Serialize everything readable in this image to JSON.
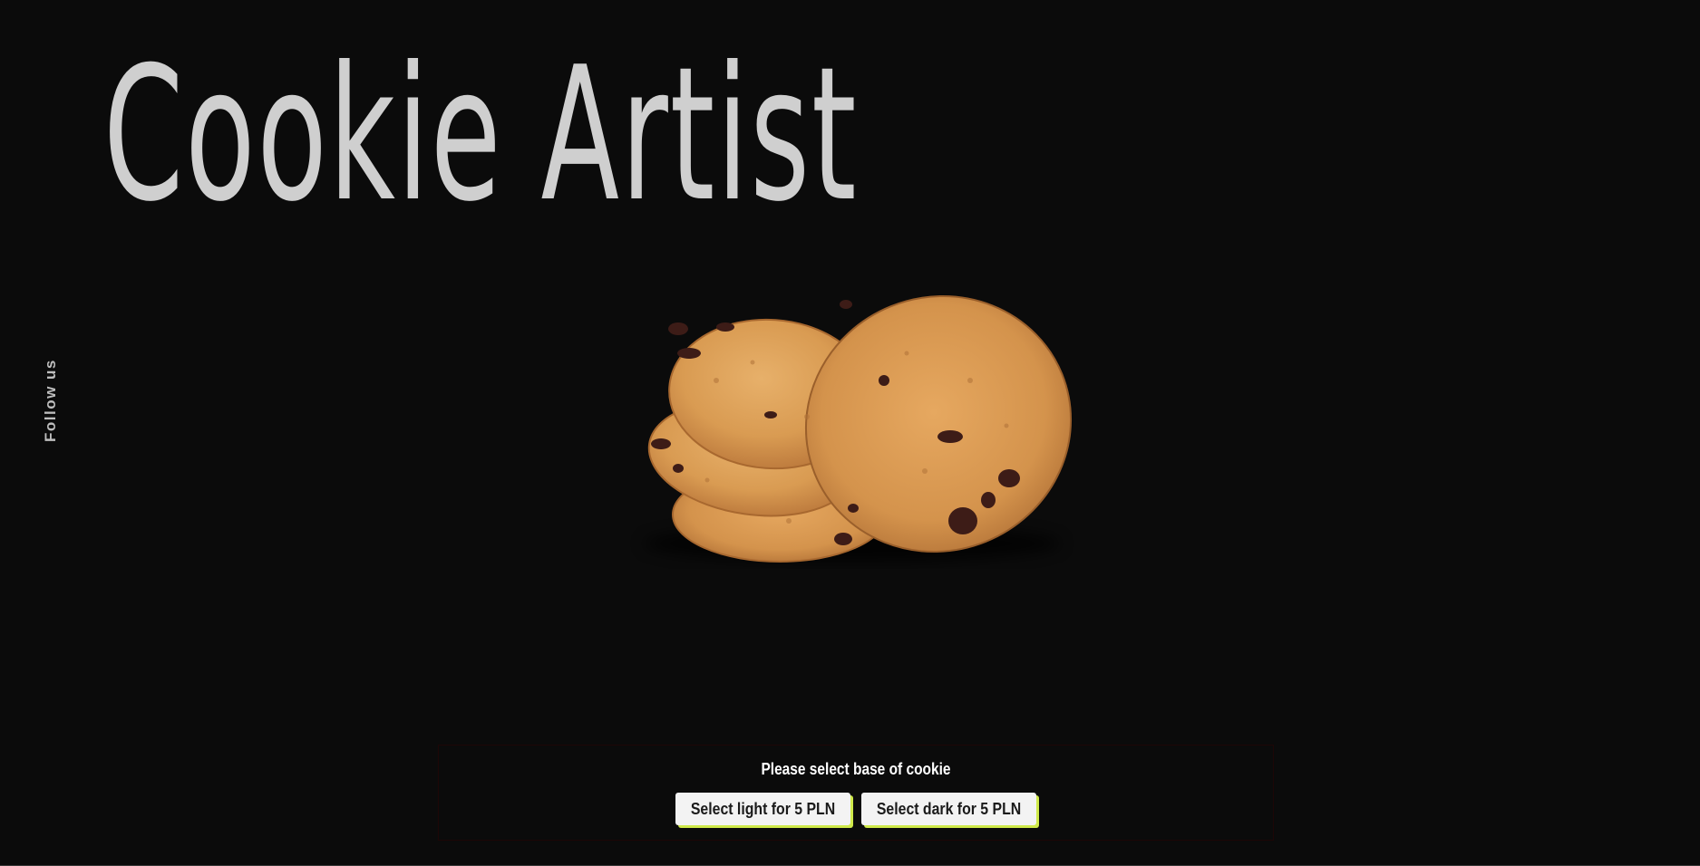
{
  "hero": {
    "title": "Cookie Artist"
  },
  "social": {
    "label": "Follow us"
  },
  "base_selector": {
    "prompt": "Please select base of cookie",
    "options": [
      {
        "label": "Select light for 5 PLN"
      },
      {
        "label": "Select dark for 5 PLN"
      }
    ],
    "button_shadow_color": "#cfe94a"
  },
  "colors": {
    "background": "#0b0b0b",
    "title": "#cfcfcf",
    "cookie": "#d9994f"
  }
}
